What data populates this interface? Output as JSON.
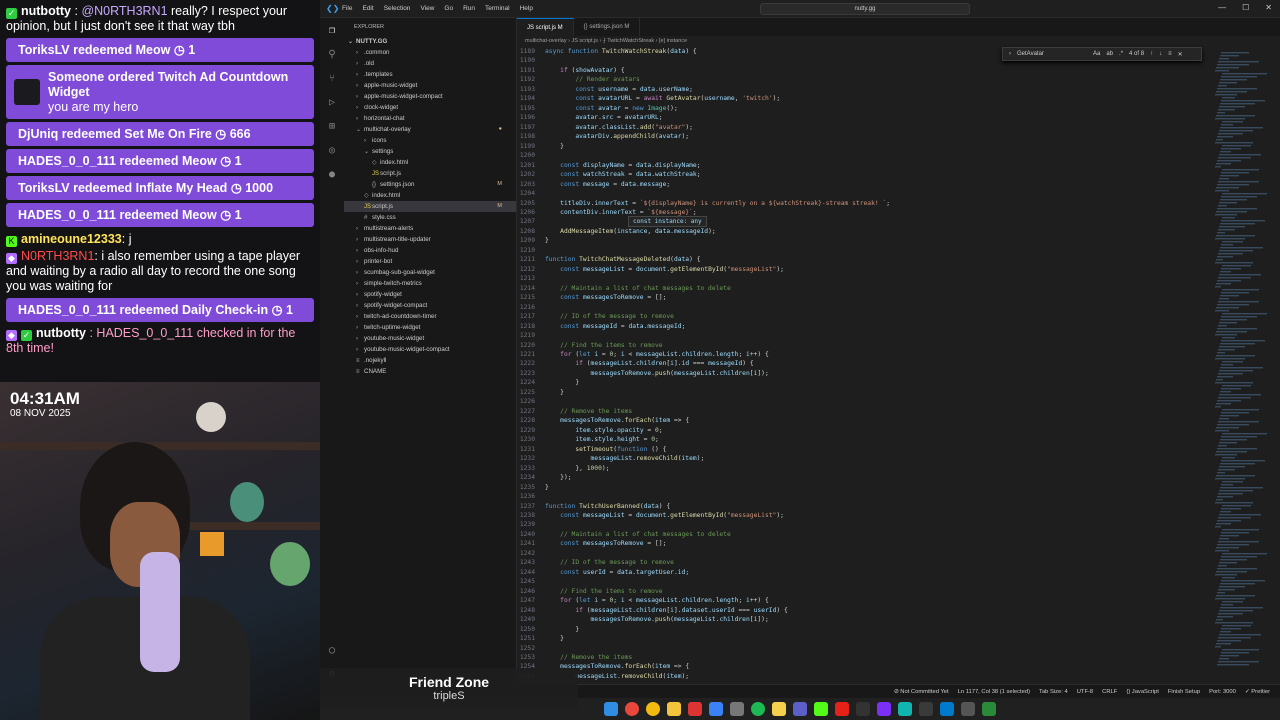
{
  "chat": {
    "m1": {
      "user": "nutbotty",
      "mention": "@N0RTH3RN1",
      "text": "really? I respect your opinion, but I just don't see it that way tbh"
    },
    "r1": {
      "text": "ToriksLV redeemed Meow",
      "pts": "1"
    },
    "ad": {
      "title": "Someone ordered Twitch Ad Countdown Widget",
      "sub": "you are my hero"
    },
    "r2": {
      "text": "DjUniq redeemed Set Me On Fire",
      "pts": "666"
    },
    "r3": {
      "text": "HADES_0_0_111 redeemed Meow",
      "pts": "1"
    },
    "r4": {
      "text": "ToriksLV redeemed Inflate My Head",
      "pts": "1000"
    },
    "r5": {
      "text": "HADES_0_0_111 redeemed Meow",
      "pts": "1"
    },
    "m2": {
      "user": "amineoune12333",
      "text": ": j"
    },
    "m3": {
      "user": "N0RTH3RN1",
      "text": ": i also remember using a tape player and waiting by a radio all day to record the one song you was waiting for"
    },
    "r6": {
      "text": "HADES_0_0_111 redeemed Daily Check-in",
      "pts": "1"
    },
    "m4": {
      "user": "nutbotty",
      "text": ": HADES_0_0_111 checked in for the 8th time!"
    }
  },
  "cam": {
    "time": "04:31AM",
    "date": "08 NOV 2025"
  },
  "song": {
    "title": "Friend Zone",
    "artist": "tripleS"
  },
  "vscode": {
    "menu": [
      "File",
      "Edit",
      "Selection",
      "View",
      "Go",
      "Run",
      "Terminal",
      "Help"
    ],
    "search": "nutty.gg",
    "explorer_title": "EXPLORER",
    "root": "NUTTY.GG",
    "tree": [
      {
        "label": ".common",
        "indent": 1,
        "icon": "›"
      },
      {
        "label": ".old",
        "indent": 1,
        "icon": "›"
      },
      {
        "label": ".templates",
        "indent": 1,
        "icon": "›"
      },
      {
        "label": "apple-music-widget",
        "indent": 1,
        "icon": "›"
      },
      {
        "label": "apple-music-widget-compact",
        "indent": 1,
        "icon": "›"
      },
      {
        "label": "clock-widget",
        "indent": 1,
        "icon": "›"
      },
      {
        "label": "horizontal-chat",
        "indent": 1,
        "icon": "›"
      },
      {
        "label": "multichat-overlay",
        "indent": 1,
        "icon": "⌄",
        "mark": "●"
      },
      {
        "label": "icons",
        "indent": 2,
        "icon": "›"
      },
      {
        "label": "settings",
        "indent": 2,
        "icon": "⌄"
      },
      {
        "label": "index.html",
        "indent": 3,
        "icon": "◇"
      },
      {
        "label": "script.js",
        "indent": 3,
        "icon": "JS"
      },
      {
        "label": "settings.json",
        "indent": 3,
        "icon": "{}",
        "mark": "M"
      },
      {
        "label": "index.html",
        "indent": 2,
        "icon": "◇"
      },
      {
        "label": "script.js",
        "indent": 2,
        "icon": "JS",
        "mark": "M"
      },
      {
        "label": "style.css",
        "indent": 2,
        "icon": "#"
      },
      {
        "label": "multistream-alerts",
        "indent": 1,
        "icon": "›"
      },
      {
        "label": "multistream-title-updater",
        "indent": 1,
        "icon": "›"
      },
      {
        "label": "obs-info-hud",
        "indent": 1,
        "icon": "›"
      },
      {
        "label": "printer-bot",
        "indent": 1,
        "icon": "›"
      },
      {
        "label": "scumbag-sub-goal-widget",
        "indent": 1,
        "icon": "›"
      },
      {
        "label": "simple-twitch-metrics",
        "indent": 1,
        "icon": "›"
      },
      {
        "label": "spotify-widget",
        "indent": 1,
        "icon": "›"
      },
      {
        "label": "spotify-widget-compact",
        "indent": 1,
        "icon": "›"
      },
      {
        "label": "twitch-ad-countdown-timer",
        "indent": 1,
        "icon": "›"
      },
      {
        "label": "twitch-uptime-widget",
        "indent": 1,
        "icon": "›"
      },
      {
        "label": "youtube-music-widget",
        "indent": 1,
        "icon": "›"
      },
      {
        "label": "youtube-music-widget-compact",
        "indent": 1,
        "icon": "›"
      },
      {
        "label": ".nojekyll",
        "indent": 1,
        "icon": "≡"
      },
      {
        "label": "CNAME",
        "indent": 1,
        "icon": "≡"
      }
    ],
    "tabs": [
      {
        "label": "JS script.js M",
        "active": true
      },
      {
        "label": "{} settings.json M",
        "active": false
      }
    ],
    "breadcrumb": "multichat-overlay › JS script.js › ⨍ TwitchWatchStreak › [e] instance",
    "find": {
      "query": "GetAvatar",
      "count": "4 of 8"
    },
    "hover": "const instance: any",
    "status": [
      "⊘ Not Committed Yet",
      "Ln 1177, Col 38 (1 selected)",
      "Tab Size: 4",
      "UTF-8",
      "CRLF",
      "{} JavaScript",
      "Finish Setup",
      "Port: 3000",
      "✓ Prettier"
    ]
  },
  "code": [
    {
      "n": "1189",
      "h": "<span class='kw'>async</span> <span class='kw'>function</span> <span class='fn'>TwitchWatchStreak</span>(<span class='vr'>data</span>) {"
    },
    {
      "n": "1190",
      "h": ""
    },
    {
      "n": "1191",
      "h": "    <span class='kp'>if</span> (<span class='vr'>showAvatar</span>) {"
    },
    {
      "n": "1192",
      "h": "        <span class='cm'>// Render avatars</span>"
    },
    {
      "n": "1193",
      "h": "        <span class='kw'>const</span> <span class='vr'>username</span> = <span class='vr'>data</span>.<span class='vr'>userName</span>;"
    },
    {
      "n": "1194",
      "h": "        <span class='kw'>const</span> <span class='vr'>avatarURL</span> = <span class='kp'>await</span> <span class='fn'>GetAvatar</span>(<span class='vr'>username</span>, <span class='st'>'twitch'</span>);"
    },
    {
      "n": "1195",
      "h": "        <span class='kw'>const</span> <span class='vr'>avatar</span> = <span class='kw'>new</span> <span class='ty'>Image</span>();"
    },
    {
      "n": "1196",
      "h": "        <span class='vr'>avatar</span>.<span class='vr'>src</span> = <span class='vr'>avatarURL</span>;"
    },
    {
      "n": "1197",
      "h": "        <span class='vr'>avatar</span>.<span class='vr'>classList</span>.<span class='fn'>add</span>(<span class='st'>\"avatar\"</span>);"
    },
    {
      "n": "1198",
      "h": "        <span class='vr'>avatarDiv</span>.<span class='fn'>appendChild</span>(<span class='vr'>avatar</span>);"
    },
    {
      "n": "1199",
      "h": "    }"
    },
    {
      "n": "1200",
      "h": ""
    },
    {
      "n": "1201",
      "h": "    <span class='kw'>const</span> <span class='vr'>displayName</span> = <span class='vr'>data</span>.<span class='vr'>displayName</span>;"
    },
    {
      "n": "1202",
      "h": "    <span class='kw'>const</span> <span class='vr'>watchStreak</span> = <span class='vr'>data</span>.<span class='vr'>watchStreak</span>;"
    },
    {
      "n": "1203",
      "h": "    <span class='kw'>const</span> <span class='vr'>message</span> = <span class='vr'>data</span>.<span class='vr'>message</span>;"
    },
    {
      "n": "1204",
      "h": ""
    },
    {
      "n": "1205",
      "h": "    <span class='vr'>titleDiv</span>.<span class='vr'>innerText</span> = <span class='st'>`${displayName} is currently on a ${watchStreak}-stream streak! `</span>;"
    },
    {
      "n": "1206",
      "h": "    <span class='vr'>contentDiv</span>.<span class='vr'>innerText</span> = <span class='st'>`${message}`</span>;"
    },
    {
      "n": "1207",
      "h": ""
    },
    {
      "n": "1208",
      "h": "    <span class='fn'>AddMessageItem</span>(<span class='vr'>instance</span>, <span class='vr'>data</span>.<span class='vr'>messageId</span>);"
    },
    {
      "n": "1209",
      "h": "}"
    },
    {
      "n": "1210",
      "h": ""
    },
    {
      "n": "1211",
      "h": "<span class='kw'>function</span> <span class='fn'>TwitchChatMessageDeleted</span>(<span class='vr'>data</span>) {"
    },
    {
      "n": "1212",
      "h": "    <span class='kw'>const</span> <span class='vr'>messageList</span> = <span class='vr'>document</span>.<span class='fn'>getElementById</span>(<span class='st'>\"messageList\"</span>);"
    },
    {
      "n": "1213",
      "h": ""
    },
    {
      "n": "1214",
      "h": "    <span class='cm'>// Maintain a list of chat messages to delete</span>"
    },
    {
      "n": "1215",
      "h": "    <span class='kw'>const</span> <span class='vr'>messagesToRemove</span> = [];"
    },
    {
      "n": "1216",
      "h": ""
    },
    {
      "n": "1217",
      "h": "    <span class='cm'>// ID of the message to remove</span>"
    },
    {
      "n": "1218",
      "h": "    <span class='kw'>const</span> <span class='vr'>messageId</span> = <span class='vr'>data</span>.<span class='vr'>messageId</span>;"
    },
    {
      "n": "1219",
      "h": ""
    },
    {
      "n": "1220",
      "h": "    <span class='cm'>// Find the items to remove</span>"
    },
    {
      "n": "1221",
      "h": "    <span class='kp'>for</span> (<span class='kw'>let</span> <span class='vr'>i</span> = <span class='nm'>0</span>; <span class='vr'>i</span> &lt; <span class='vr'>messageList</span>.<span class='vr'>children</span>.<span class='vr'>length</span>; <span class='vr'>i</span>++) {"
    },
    {
      "n": "1222",
      "h": "        <span class='kp'>if</span> (<span class='vr'>messageList</span>.<span class='vr'>children</span>[<span class='vr'>i</span>].<span class='vr'>id</span> === <span class='vr'>messageId</span>) {"
    },
    {
      "n": "1223",
      "h": "            <span class='vr'>messagesToRemove</span>.<span class='fn'>push</span>(<span class='vr'>messageList</span>.<span class='vr'>children</span>[<span class='vr'>i</span>]);"
    },
    {
      "n": "1224",
      "h": "        }"
    },
    {
      "n": "1225",
      "h": "    }"
    },
    {
      "n": "1226",
      "h": ""
    },
    {
      "n": "1227",
      "h": "    <span class='cm'>// Remove the items</span>"
    },
    {
      "n": "1228",
      "h": "    <span class='vr'>messagesToRemove</span>.<span class='fn'>forEach</span>(<span class='vr'>item</span> =&gt; {"
    },
    {
      "n": "1229",
      "h": "        <span class='vr'>item</span>.<span class='vr'>style</span>.<span class='vr'>opacity</span> = <span class='nm'>0</span>;"
    },
    {
      "n": "1230",
      "h": "        <span class='vr'>item</span>.<span class='vr'>style</span>.<span class='vr'>height</span> = <span class='nm'>0</span>;"
    },
    {
      "n": "1231",
      "h": "        <span class='fn'>setTimeout</span>(<span class='kw'>function</span> () {"
    },
    {
      "n": "1232",
      "h": "            <span class='vr'>messageList</span>.<span class='fn'>removeChild</span>(<span class='vr'>item</span>);"
    },
    {
      "n": "1233",
      "h": "        }, <span class='nm'>1000</span>);"
    },
    {
      "n": "1234",
      "h": "    });"
    },
    {
      "n": "1235",
      "h": "}"
    },
    {
      "n": "1236",
      "h": ""
    },
    {
      "n": "1237",
      "h": "<span class='kw'>function</span> <span class='fn'>TwitchUserBanned</span>(<span class='vr'>data</span>) {"
    },
    {
      "n": "1238",
      "h": "    <span class='kw'>const</span> <span class='vr'>messageList</span> = <span class='vr'>document</span>.<span class='fn'>getElementById</span>(<span class='st'>\"messageList\"</span>);"
    },
    {
      "n": "1239",
      "h": ""
    },
    {
      "n": "1240",
      "h": "    <span class='cm'>// Maintain a list of chat messages to delete</span>"
    },
    {
      "n": "1241",
      "h": "    <span class='kw'>const</span> <span class='vr'>messagesToRemove</span> = [];"
    },
    {
      "n": "1242",
      "h": ""
    },
    {
      "n": "1243",
      "h": "    <span class='cm'>// ID of the message to remove</span>"
    },
    {
      "n": "1244",
      "h": "    <span class='kw'>const</span> <span class='vr'>userId</span> = <span class='vr'>data</span>.<span class='vr'>targetUser</span>.<span class='vr'>id</span>;"
    },
    {
      "n": "1245",
      "h": ""
    },
    {
      "n": "1246",
      "h": "    <span class='cm'>// Find the items to remove</span>"
    },
    {
      "n": "1247",
      "h": "    <span class='kp'>for</span> (<span class='kw'>let</span> <span class='vr'>i</span> = <span class='nm'>0</span>; <span class='vr'>i</span> &lt; <span class='vr'>messageList</span>.<span class='vr'>children</span>.<span class='vr'>length</span>; <span class='vr'>i</span>++) {"
    },
    {
      "n": "1248",
      "h": "        <span class='kp'>if</span> (<span class='vr'>messageList</span>.<span class='vr'>children</span>[<span class='vr'>i</span>].<span class='vr'>dataset</span>.<span class='vr'>userId</span> === <span class='vr'>userId</span>) {"
    },
    {
      "n": "1249",
      "h": "            <span class='vr'>messagesToRemove</span>.<span class='fn'>push</span>(<span class='vr'>messageList</span>.<span class='vr'>children</span>[<span class='vr'>i</span>]);"
    },
    {
      "n": "1250",
      "h": "        }"
    },
    {
      "n": "1251",
      "h": "    }"
    },
    {
      "n": "1252",
      "h": ""
    },
    {
      "n": "1253",
      "h": "    <span class='cm'>// Remove the items</span>"
    },
    {
      "n": "1254",
      "h": "    <span class='vr'>messagesToRemove</span>.<span class='fn'>forEach</span>(<span class='vr'>item</span> =&gt; {"
    },
    {
      "n": "1255",
      "h": "        <span class='vr'>messageList</span>.<span class='fn'>removeChild</span>(<span class='vr'>item</span>);"
    }
  ]
}
